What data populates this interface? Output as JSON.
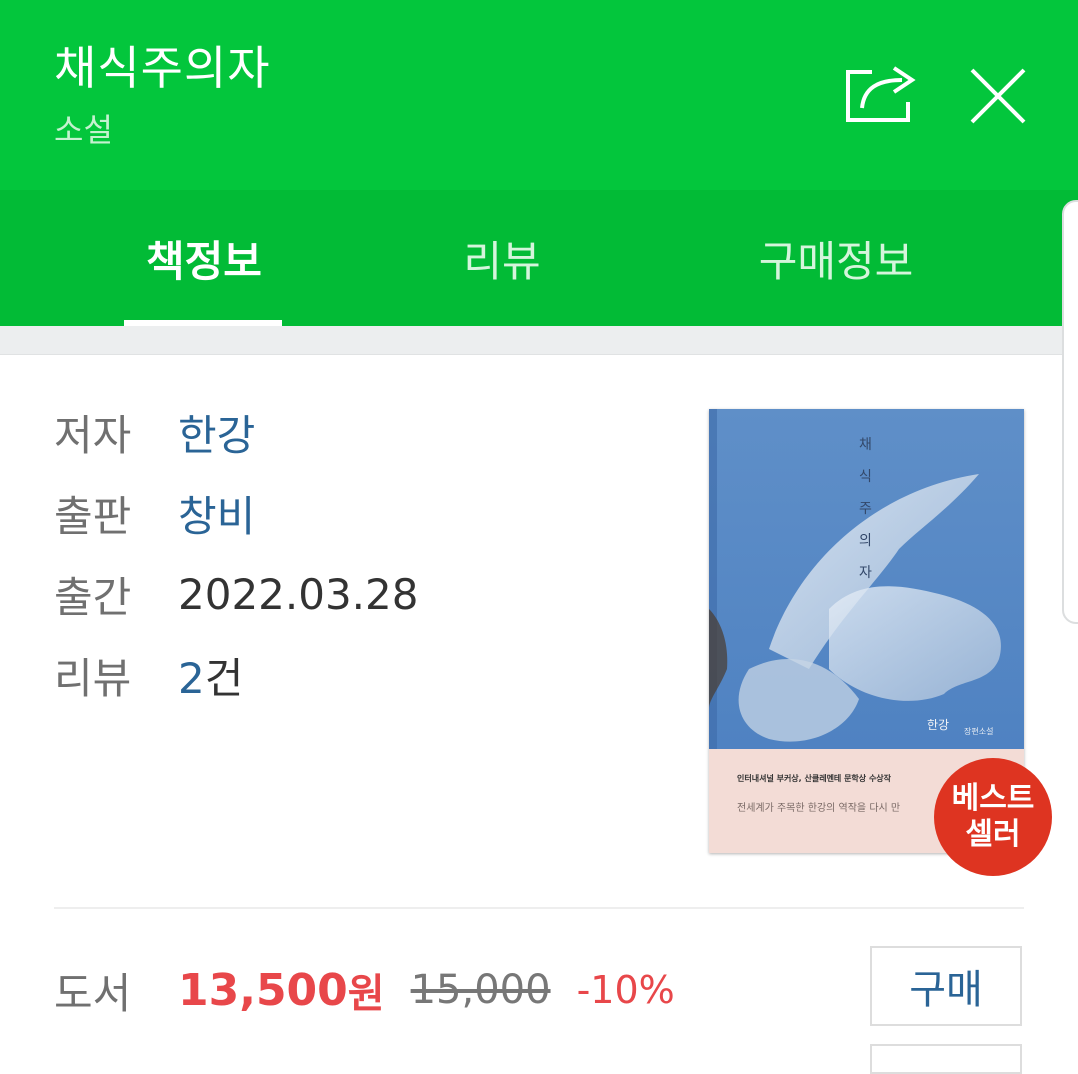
{
  "header": {
    "title": "채식주의자",
    "subtitle": "소설",
    "share_icon": "share-icon",
    "close_icon": "close-icon",
    "bg_color": "#03c63c"
  },
  "tabs": [
    {
      "label": "책정보",
      "active": true
    },
    {
      "label": "리뷰",
      "active": false
    },
    {
      "label": "구매정보",
      "active": false
    }
  ],
  "info": {
    "author_label": "저자",
    "author": "한강",
    "publisher_label": "출판",
    "publisher": "창비",
    "date_label": "출간",
    "date": "2022.03.28",
    "review_label": "리뷰",
    "review_count": "2",
    "review_unit": "건"
  },
  "cover": {
    "title_vertical": "채식주의자",
    "author": "한강",
    "series": "장편소설",
    "band_line1": "인터내셔널 부커상, 산클레멘테 문학상 수상작",
    "band_line2": "전세계가 주목한 한강의 역작을 다시 만"
  },
  "badge": {
    "line1": "베스트",
    "line2": "셀러",
    "color": "#de3421"
  },
  "price": {
    "label": "도서",
    "sale": "13,500",
    "unit": "원",
    "original": "15,000",
    "discount": "-10%",
    "buy_label": "구매"
  }
}
